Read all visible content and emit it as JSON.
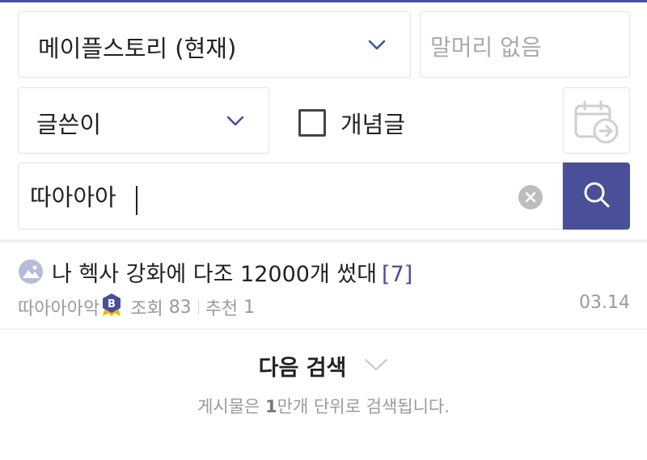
{
  "filters": {
    "board": {
      "selected": "메이플스토리 (현재)",
      "icon": "chevron-down-icon"
    },
    "prefix": {
      "placeholder": "말머리 없음"
    },
    "field": {
      "selected": "글쓴이",
      "icon": "chevron-down-icon"
    },
    "concept_checkbox": {
      "label": "개념글",
      "checked": false
    },
    "date_button": {
      "icon": "calendar-arrow-icon"
    }
  },
  "search": {
    "value": "따아아아",
    "clear_icon": "clear-icon",
    "button_icon": "search-icon"
  },
  "results": [
    {
      "icon": "image-placeholder-icon",
      "title": "나 헥사 강화에 다조 12000개 썼대",
      "comments": "[7]",
      "author": "따아아아악",
      "author_badge": "B",
      "views_label": "조회",
      "views": "83",
      "recommend_label": "추천",
      "recommend": "1",
      "date": "03.14"
    }
  ],
  "next_search": {
    "label": "다음 검색",
    "icon": "chevron-down-icon",
    "note_prefix": "게시물은 ",
    "note_strong": "1",
    "note_suffix": "만개 단위로 검색됩니다."
  },
  "colors": {
    "accent": "#4a4f9a",
    "badge": "#4a4f9a",
    "badge_ribbon": "#f0b400"
  }
}
